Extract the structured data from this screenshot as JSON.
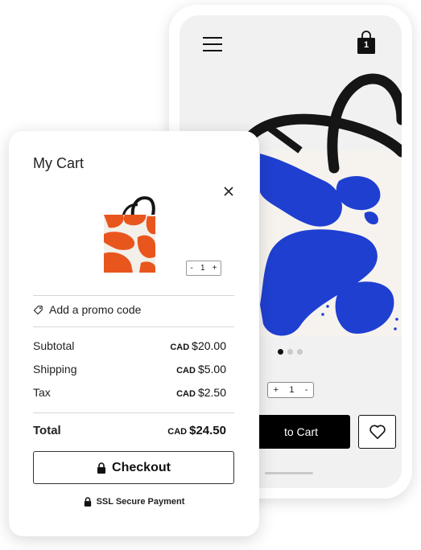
{
  "product_page": {
    "cart_count": "1",
    "quantity": {
      "minus": "-",
      "value": "1",
      "plus": "+"
    },
    "quantity_order": [
      "+",
      "1",
      "-"
    ],
    "add_to_cart_label": "to Cart",
    "gallery_dots": 3,
    "active_dot": 0
  },
  "cart": {
    "title": "My Cart",
    "item_quantity": {
      "minus": "-",
      "value": "1",
      "plus": "+"
    },
    "promo_label": "Add a promo code",
    "rows": [
      {
        "label": "Subtotal",
        "currency": "CAD",
        "amount": "$20.00"
      },
      {
        "label": "Shipping",
        "currency": "CAD",
        "amount": "$5.00"
      },
      {
        "label": "Tax",
        "currency": "CAD",
        "amount": "$2.50"
      }
    ],
    "total": {
      "label": "Total",
      "currency": "CAD",
      "amount": "$24.50"
    },
    "checkout_label": "Checkout",
    "secure_label": "SSL Secure Payment"
  },
  "colors": {
    "artwork_blue": "#1f3fd1",
    "artwork_orange": "#e8561e",
    "button_black": "#000000"
  }
}
